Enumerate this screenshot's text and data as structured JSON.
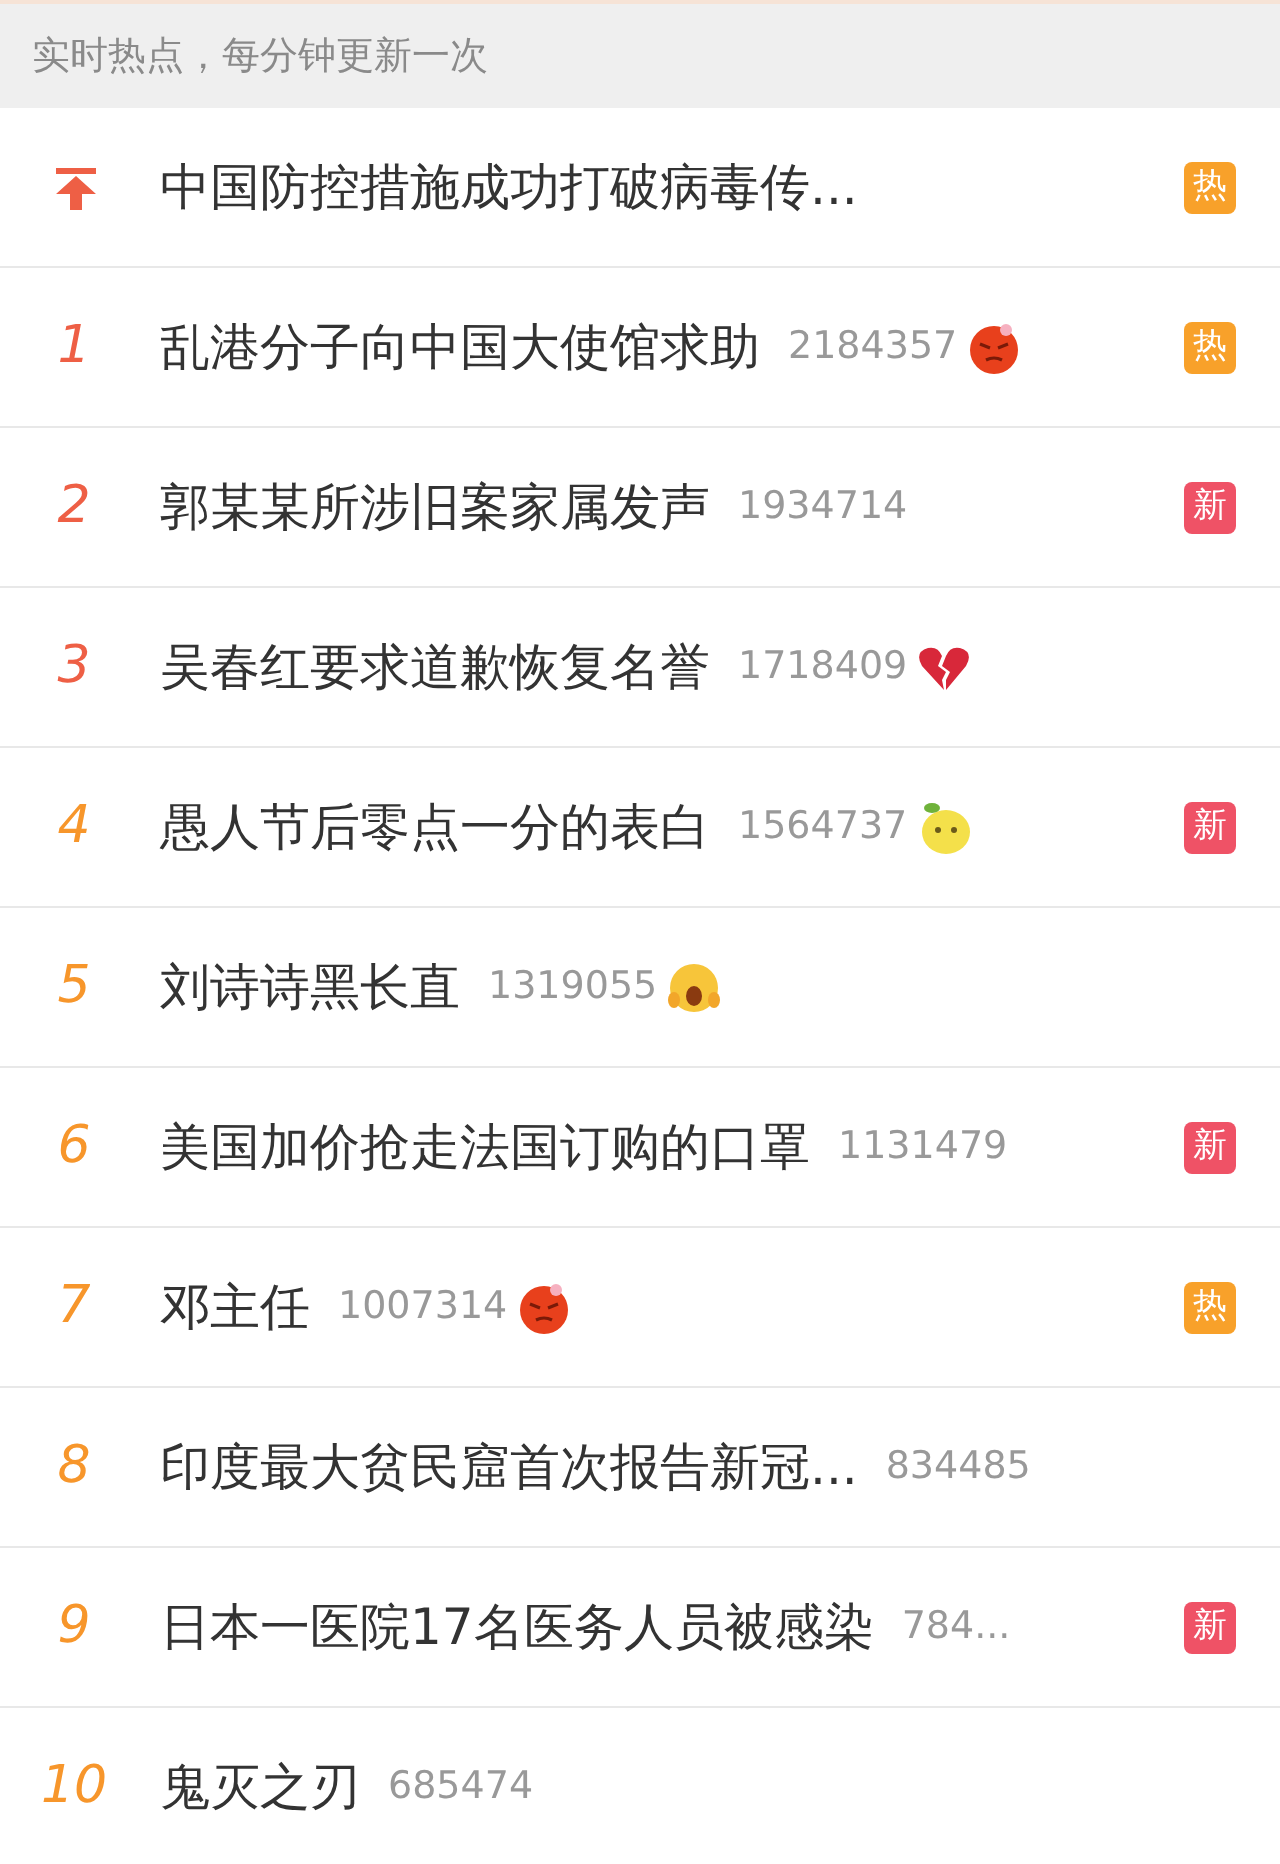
{
  "header": {
    "text": "实时热点，每分钟更新一次"
  },
  "items": [
    {
      "kind": "pinned",
      "title": "中国防控措施成功打破病毒传...",
      "badge": {
        "kind": "hot",
        "text": "热"
      }
    },
    {
      "kind": "ranked",
      "rank": "1",
      "color": "#ee5f45",
      "title": "乱港分子向中国大使馆求助",
      "count": "2184357",
      "emoji": {
        "kind": "angry"
      },
      "badge": {
        "kind": "hot",
        "text": "热"
      }
    },
    {
      "kind": "ranked",
      "rank": "2",
      "color": "#ee5f45",
      "title": "郭某某所涉旧案家属发声",
      "count": "1934714",
      "badge": {
        "kind": "new",
        "text": "新"
      }
    },
    {
      "kind": "ranked",
      "rank": "3",
      "color": "#ee5f45",
      "title": "吴春红要求道歉恢复名誉",
      "count": "1718409",
      "emoji": {
        "kind": "broken-heart"
      }
    },
    {
      "kind": "ranked",
      "rank": "4",
      "color": "#f7962b",
      "title": "愚人节后零点一分的表白",
      "count": "1564737",
      "emoji": {
        "kind": "lemon"
      },
      "badge": {
        "kind": "new",
        "text": "新"
      }
    },
    {
      "kind": "ranked",
      "rank": "5",
      "color": "#f7962b",
      "title": "刘诗诗黑长直",
      "count": "1319055",
      "emoji": {
        "kind": "shocked"
      }
    },
    {
      "kind": "ranked",
      "rank": "6",
      "color": "#f7962b",
      "title": "美国加价抢走法国订购的口罩",
      "count": "1131479",
      "badge": {
        "kind": "new",
        "text": "新"
      }
    },
    {
      "kind": "ranked",
      "rank": "7",
      "color": "#f7962b",
      "title": "邓主任",
      "count": "1007314",
      "emoji": {
        "kind": "angry"
      },
      "badge": {
        "kind": "hot",
        "text": "热"
      }
    },
    {
      "kind": "ranked",
      "rank": "8",
      "color": "#f7962b",
      "title": "印度最大贫民窟首次报告新冠...",
      "count": "834485"
    },
    {
      "kind": "ranked",
      "rank": "9",
      "color": "#f7962b",
      "title": "日本一医院17名医务人员被感染",
      "count": "784...",
      "badge": {
        "kind": "new",
        "text": "新"
      }
    },
    {
      "kind": "ranked",
      "rank": "10",
      "color": "#f7962b",
      "title": "鬼灭之刃",
      "count": "685474"
    }
  ]
}
